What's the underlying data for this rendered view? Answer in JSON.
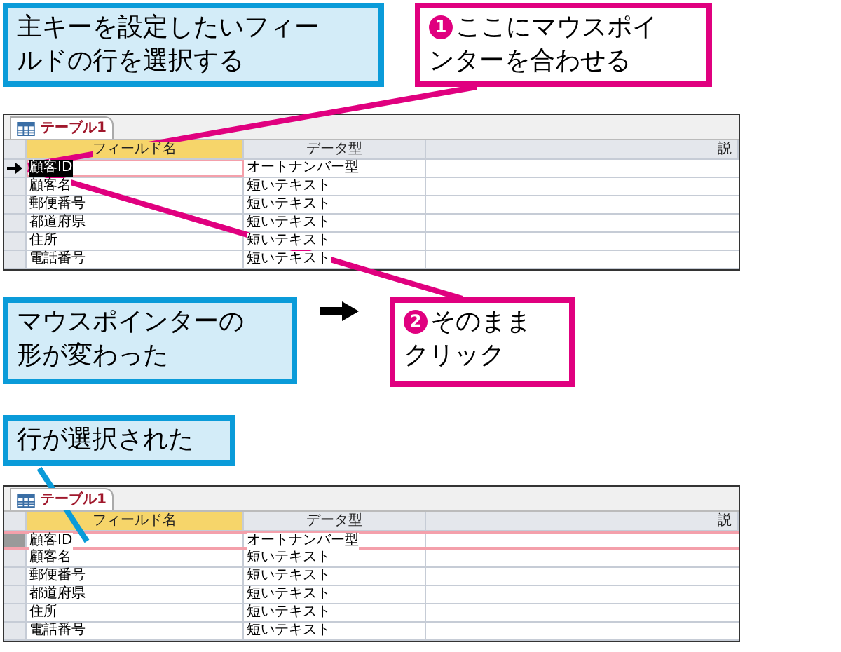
{
  "top_callouts": [
    {
      "kind": "note",
      "text": "主キーを設定したいフィールドの行を選択する"
    },
    {
      "kind": "step",
      "number": "1",
      "text": "ここにマウスポインターを合わせる"
    }
  ],
  "tables": [
    {
      "tab": "テーブル1",
      "columns": [
        "フィールド名",
        "データ型",
        "説"
      ],
      "rows": [
        {
          "name": "顧客ID",
          "type": "オートナンバー型",
          "current": true,
          "selected": false
        },
        {
          "name": "顧客名",
          "type": "短いテキスト",
          "current": false,
          "selected": false
        },
        {
          "name": "郵便番号",
          "type": "短いテキスト",
          "current": false,
          "selected": false
        },
        {
          "name": "都道府県",
          "type": "短いテキスト",
          "current": false,
          "selected": false
        },
        {
          "name": "住所",
          "type": "短いテキスト",
          "current": false,
          "selected": false
        },
        {
          "name": "電話番号",
          "type": "短いテキスト",
          "current": false,
          "selected": false
        }
      ]
    },
    {
      "tab": "テーブル1",
      "columns": [
        "フィールド名",
        "データ型",
        "説"
      ],
      "rows": [
        {
          "name": "顧客ID",
          "type": "オートナンバー型",
          "current": false,
          "selected": true
        },
        {
          "name": "顧客名",
          "type": "短いテキスト",
          "current": false,
          "selected": false
        },
        {
          "name": "郵便番号",
          "type": "短いテキスト",
          "current": false,
          "selected": false
        },
        {
          "name": "都道府県",
          "type": "短いテキスト",
          "current": false,
          "selected": false
        },
        {
          "name": "住所",
          "type": "短いテキスト",
          "current": false,
          "selected": false
        },
        {
          "name": "電話番号",
          "type": "短いテキスト",
          "current": false,
          "selected": false
        }
      ]
    }
  ],
  "middle_callouts": [
    {
      "kind": "note",
      "text": "マウスポインターの形が変わった"
    },
    {
      "kind": "step",
      "number": "2",
      "text": "そのままクリック"
    }
  ],
  "bottom_callout": {
    "kind": "note",
    "text": "行が選択された"
  }
}
